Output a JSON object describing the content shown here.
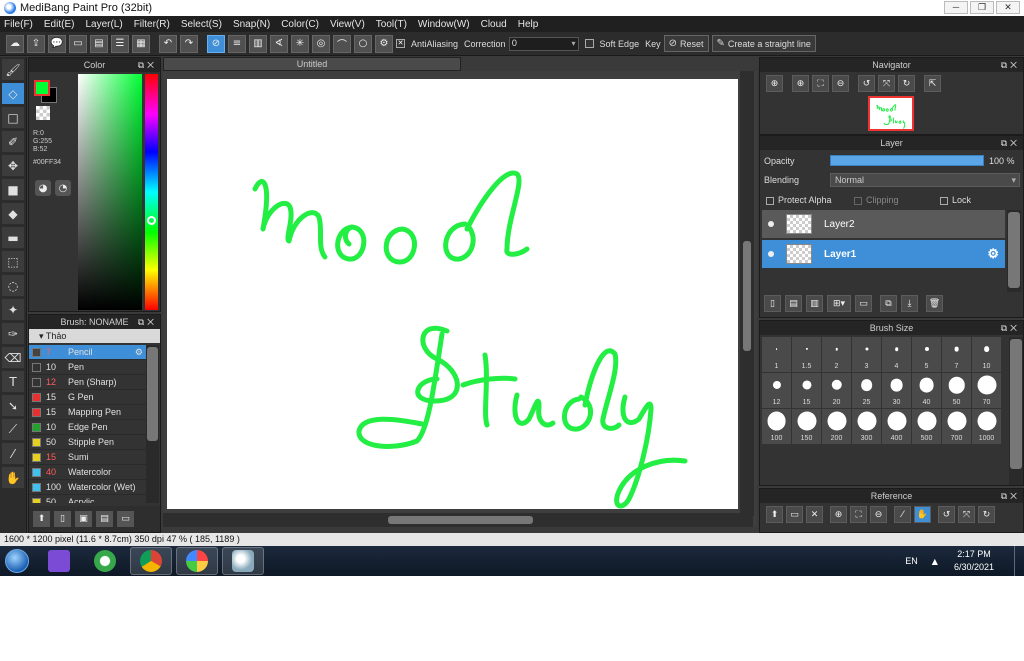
{
  "window": {
    "title": "MediBang Paint Pro (32bit)",
    "controls": [
      "─",
      "❐",
      "✕"
    ]
  },
  "menu": [
    "File(F)",
    "Edit(E)",
    "Layer(L)",
    "Filter(R)",
    "Select(S)",
    "Snap(N)",
    "Color(C)",
    "View(V)",
    "Tool(T)",
    "Window(W)",
    "Cloud",
    "Help"
  ],
  "toolbar": {
    "antialiasing_label": "AntiAliasing",
    "antialiasing_checked": true,
    "correction_label": "Correction",
    "correction_value": "0",
    "soft_edge_label": "Soft Edge",
    "key_label": "Key",
    "reset_label": "Reset",
    "straight_line_label": "Create a straight line"
  },
  "color_panel": {
    "title": "Color",
    "r": "R:0",
    "g": "G:255",
    "b": "B:52",
    "hex": "#00FF34",
    "color": "#00ff34"
  },
  "brush_panel": {
    "title": "Brush: NONAME",
    "group": "Thảo",
    "items": [
      {
        "size": "7",
        "name": "Pencil",
        "color": "#444444",
        "size_red": true,
        "selected": true
      },
      {
        "size": "10",
        "name": "Pen",
        "color": "#333333",
        "size_red": false,
        "selected": false
      },
      {
        "size": "12",
        "name": "Pen (Sharp)",
        "color": "#333333",
        "size_red": true,
        "selected": false
      },
      {
        "size": "15",
        "name": "G Pen",
        "color": "#e83030",
        "size_red": false,
        "selected": false
      },
      {
        "size": "15",
        "name": "Mapping Pen",
        "color": "#e83030",
        "size_red": false,
        "selected": false
      },
      {
        "size": "10",
        "name": "Edge Pen",
        "color": "#22a22a",
        "size_red": false,
        "selected": false
      },
      {
        "size": "50",
        "name": "Stipple Pen",
        "color": "#e8d020",
        "size_red": false,
        "selected": false
      },
      {
        "size": "15",
        "name": "Sumi",
        "color": "#e8d020",
        "size_red": true,
        "selected": false
      },
      {
        "size": "40",
        "name": "Watercolor",
        "color": "#40c0f0",
        "size_red": true,
        "selected": false
      },
      {
        "size": "100",
        "name": "Watercolor (Wet)",
        "color": "#40c0f0",
        "size_red": false,
        "selected": false
      },
      {
        "size": "50",
        "name": "Acrylic",
        "color": "#e8d020",
        "size_red": false,
        "selected": false
      }
    ]
  },
  "canvas": {
    "tab_title": "Untitled",
    "word1": "Mood",
    "word2": "Study",
    "stroke_color": "#22ee44"
  },
  "navigator": {
    "title": "Navigator"
  },
  "layer_panel": {
    "title": "Layer",
    "opacity_label": "Opacity",
    "opacity_value": "100 %",
    "blending_label": "Blending",
    "blending_value": "Normal",
    "protect_alpha_label": "Protect Alpha",
    "clipping_label": "Clipping",
    "lock_label": "Lock",
    "layers": [
      {
        "name": "Layer2",
        "selected": false
      },
      {
        "name": "Layer1",
        "selected": true
      }
    ]
  },
  "brush_size": {
    "title": "Brush Size",
    "sizes": [
      "1",
      "1.5",
      "2",
      "3",
      "4",
      "5",
      "7",
      "10",
      "12",
      "15",
      "20",
      "25",
      "30",
      "40",
      "50",
      "70",
      "100",
      "150",
      "200",
      "300",
      "400",
      "500",
      "700",
      "1000"
    ]
  },
  "reference": {
    "title": "Reference"
  },
  "status": {
    "text": "1600 * 1200 pixel   (11.6 * 8.7cm)   350 dpi   47 %   ( 185, 1189 )"
  },
  "taskbar": {
    "lang": "EN",
    "time": "2:17 PM",
    "date": "6/30/2021"
  }
}
